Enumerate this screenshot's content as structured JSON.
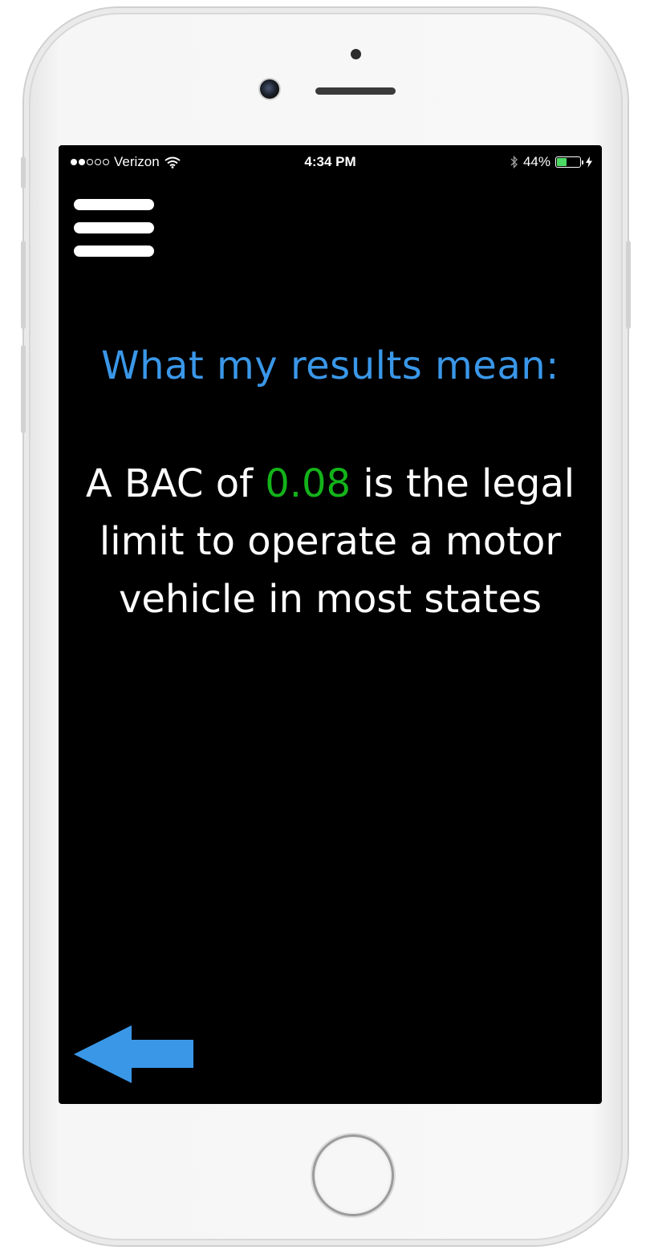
{
  "status_bar": {
    "carrier": "Verizon",
    "time": "4:34 PM",
    "battery_percent": "44%",
    "battery_level": 0.44,
    "signal_bars_filled": 2,
    "signal_bars_total": 5
  },
  "page": {
    "heading": "What my results mean:",
    "message_prefix": "A BAC of ",
    "bac_value": "0.08",
    "message_suffix": " is the legal limit to operate a motor vehicle in most states"
  },
  "colors": {
    "heading": "#3a97e8",
    "bac_value": "#13b31a",
    "back_arrow": "#3a97e8",
    "background": "#000000"
  },
  "icons": {
    "menu": "hamburger-menu-icon",
    "back": "left-arrow-icon",
    "wifi": "wifi-icon",
    "bluetooth": "bluetooth-icon",
    "battery": "battery-icon",
    "charging": "charging-bolt-icon"
  }
}
